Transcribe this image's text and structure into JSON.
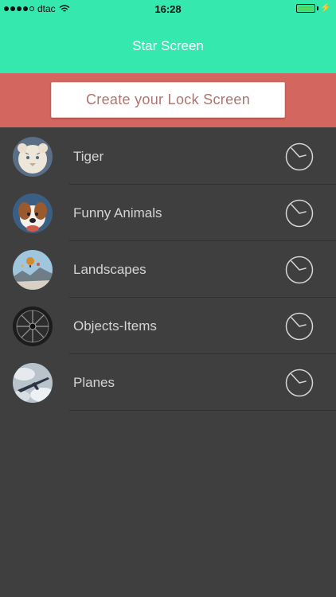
{
  "status_bar": {
    "carrier": "dtac",
    "time": "16:28",
    "signal_bars": 4,
    "battery_level": 1.0,
    "charging": true
  },
  "header": {
    "title": "Star Screen",
    "bg_color": "#35e8ae"
  },
  "banner": {
    "button_label": "Create your Lock Screen",
    "bg_color": "#d3675f"
  },
  "categories": [
    {
      "label": "Tiger",
      "thumb": "white-tiger-thumbnail",
      "icon": "timer-icon"
    },
    {
      "label": "Funny Animals",
      "thumb": "dog-thumbnail",
      "icon": "timer-icon"
    },
    {
      "label": "Landscapes",
      "thumb": "balloon-landscape-thumbnail",
      "icon": "timer-icon"
    },
    {
      "label": "Objects-Items",
      "thumb": "fan-thumbnail",
      "icon": "timer-icon"
    },
    {
      "label": "Planes",
      "thumb": "plane-clouds-thumbnail",
      "icon": "timer-icon"
    }
  ]
}
